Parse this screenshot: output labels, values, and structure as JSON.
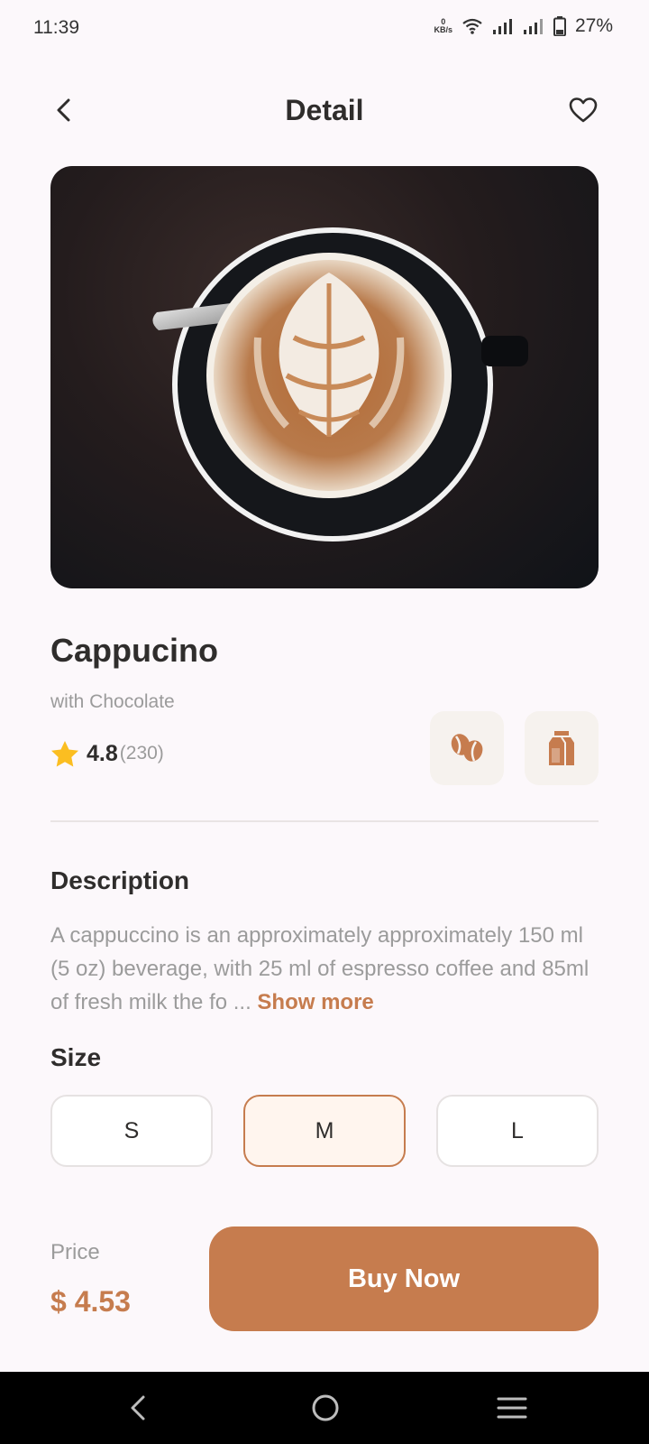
{
  "status_bar": {
    "time": "11:39",
    "net_speed_value": "0",
    "net_speed_unit": "KB/s",
    "battery": "27%"
  },
  "header": {
    "title": "Detail",
    "back_icon": "chevron-left-icon",
    "favorite_icon": "heart-outline-icon"
  },
  "product": {
    "name": "Cappucino",
    "subtitle": "with Chocolate",
    "rating": "4.8",
    "rating_count": "(230)",
    "features": [
      {
        "icon": "coffee-bean-icon"
      },
      {
        "icon": "milk-carton-icon"
      }
    ]
  },
  "description": {
    "title": "Description",
    "text": "A cappuccino is an approximately approximately 150 ml (5 oz) beverage, with 25 ml of espresso coffee and 85ml of fresh milk the fo ... ",
    "show_more": "Show more"
  },
  "size": {
    "title": "Size",
    "options": [
      "S",
      "M",
      "L"
    ],
    "selected": "M"
  },
  "purchase": {
    "price_label": "Price",
    "price": "$ 4.53",
    "buy_label": "Buy Now"
  },
  "colors": {
    "accent": "#c67c4e",
    "accent_light": "#fff5ee",
    "star": "#fbbe21",
    "text_dark": "#2f2d2c",
    "text_muted": "#9b9b9b"
  }
}
